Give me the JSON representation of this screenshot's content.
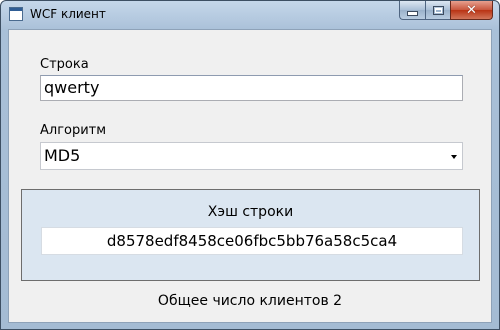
{
  "window": {
    "title": "WCF клиент",
    "icons": {
      "app": "app-window-icon",
      "minimize": "minimize-icon",
      "maximize": "maximize-icon",
      "close": "close-icon"
    },
    "close_color": "#c7452a",
    "accent_panel_color": "#dbe6f1"
  },
  "form": {
    "string_label": "Строка",
    "string_value": "qwerty",
    "algorithm_label": "Алгоритм",
    "algorithm_selected": "MD5",
    "hash_panel_title": "Хэш строки",
    "hash_value": "d8578edf8458ce06fbc5bb76a58c5ca4",
    "clients_text": "Общее число клиентов 2"
  }
}
